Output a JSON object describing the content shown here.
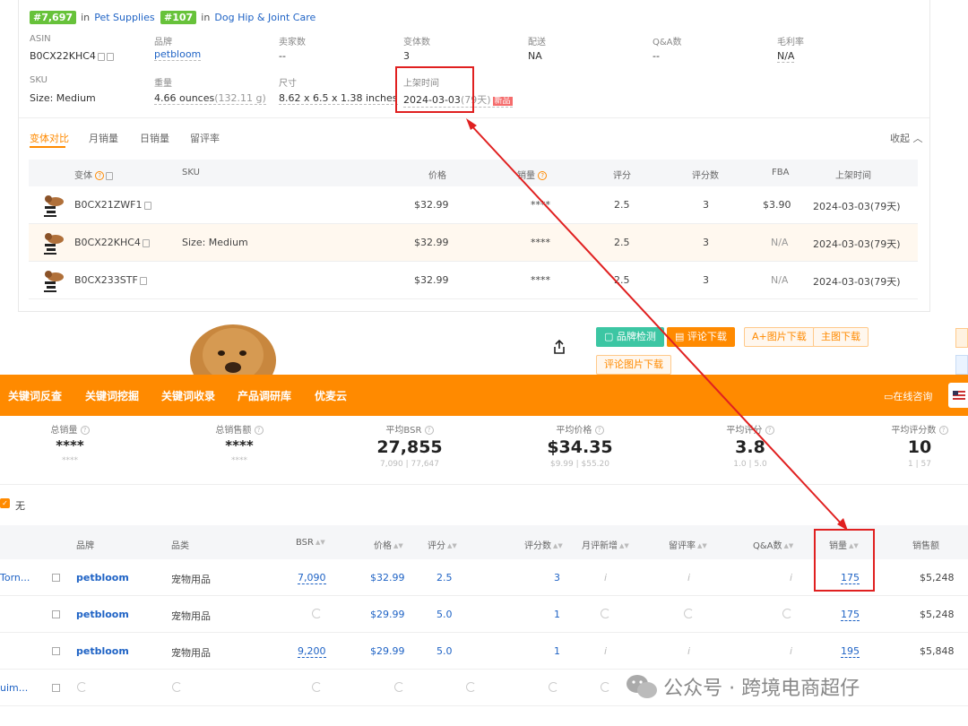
{
  "ranks": [
    {
      "badge": "#7,697",
      "in": "in",
      "category": "Pet Supplies"
    },
    {
      "badge": "#107",
      "in": "in",
      "category": "Dog Hip & Joint Care"
    }
  ],
  "info": {
    "row1": [
      {
        "label": "ASIN",
        "value": "B0CX22KHC4"
      },
      {
        "label": "品牌",
        "value": "petbloom"
      },
      {
        "label": "卖家数",
        "value": "--"
      },
      {
        "label": "变体数",
        "value": "3"
      },
      {
        "label": "配送",
        "value": "NA"
      },
      {
        "label": "Q&A数",
        "value": "--"
      },
      {
        "label": "毛利率",
        "value": "N/A"
      }
    ],
    "row2": [
      {
        "label": "SKU",
        "value": "Size: Medium"
      },
      {
        "label": "重量",
        "value": "4.66 ounces",
        "extra": "(132.11 g)"
      },
      {
        "label": "尺寸",
        "value": "8.62 x 6.5 x 1.38 inches"
      },
      {
        "label": "上架时间",
        "value": "2024-03-03",
        "extra": "(79天)",
        "tag": "新品"
      }
    ]
  },
  "tabs": [
    "变体对比",
    "月销量",
    "日销量",
    "留评率"
  ],
  "collapse": "收起",
  "variant_headers": [
    "变体",
    "SKU",
    "价格",
    "销量",
    "评分",
    "评分数",
    "FBA",
    "上架时间"
  ],
  "variants": [
    {
      "asin": "B0CX21ZWF1",
      "sku": "",
      "price": "$32.99",
      "sales": "****",
      "rating": "2.5",
      "count": "3",
      "fba": "$3.90",
      "date": "2024-03-03(79天)"
    },
    {
      "asin": "B0CX22KHC4",
      "sku": "Size: Medium",
      "price": "$32.99",
      "sales": "****",
      "rating": "2.5",
      "count": "3",
      "fba": "N/A",
      "date": "2024-03-03(79天)"
    },
    {
      "asin": "B0CX233STF",
      "sku": "",
      "price": "$32.99",
      "sales": "****",
      "rating": "2.5",
      "count": "3",
      "fba": "N/A",
      "date": "2024-03-03(79天)"
    }
  ],
  "actions": {
    "brand_check": "品牌检测",
    "review_download": "评论下载",
    "aplus_download": "A+图片下载",
    "main_download": "主图下载",
    "review_img_download": "评论图片下载"
  },
  "nav": {
    "items": [
      "关键词反查",
      "关键词挖掘",
      "关键词收录",
      "产品调研库",
      "优麦云"
    ],
    "consult": "在线咨询"
  },
  "stats": [
    {
      "title": "总销量",
      "value": "****",
      "range": "****"
    },
    {
      "title": "总销售额",
      "value": "****",
      "range": "****"
    },
    {
      "title": "平均BSR",
      "value": "27,855",
      "range": "7,090 | 77,647"
    },
    {
      "title": "平均价格",
      "value": "$34.35",
      "range": "$9.99 | $55.20"
    },
    {
      "title": "平均评分",
      "value": "3.8",
      "range": "1.0 | 5.0"
    },
    {
      "title": "平均评分数",
      "value": "10",
      "range": "1 | 57"
    }
  ],
  "filter_label": "无",
  "table_headers": [
    "品牌",
    "品类",
    "BSR",
    "价格",
    "评分",
    "评分数",
    "月评新增",
    "留评率",
    "Q&A数",
    "销量",
    "销售额"
  ],
  "rows": [
    {
      "name": "Torn...",
      "brand": "petbloom",
      "cat": "宠物用品",
      "bsr": "7,090",
      "price": "$32.99",
      "rating": "2.5",
      "count": "3",
      "qa": "i",
      "sales": "175",
      "revenue": "$5,248"
    },
    {
      "name": "",
      "brand": "petbloom",
      "cat": "宠物用品",
      "bsr": "",
      "price": "$29.99",
      "rating": "5.0",
      "count": "1",
      "qa": "",
      "sales": "175",
      "revenue": "$5,248"
    },
    {
      "name": "",
      "brand": "petbloom",
      "cat": "宠物用品",
      "bsr": "9,200",
      "price": "$29.99",
      "rating": "5.0",
      "count": "1",
      "qa": "i",
      "sales": "195",
      "revenue": "$5,848"
    },
    {
      "name": "uim...",
      "brand": "",
      "cat": "",
      "bsr": "",
      "price": "",
      "rating": "",
      "count": "",
      "qa": "",
      "sales": "",
      "revenue": ""
    }
  ],
  "watermark": "公众号 · 跨境电商超仔"
}
